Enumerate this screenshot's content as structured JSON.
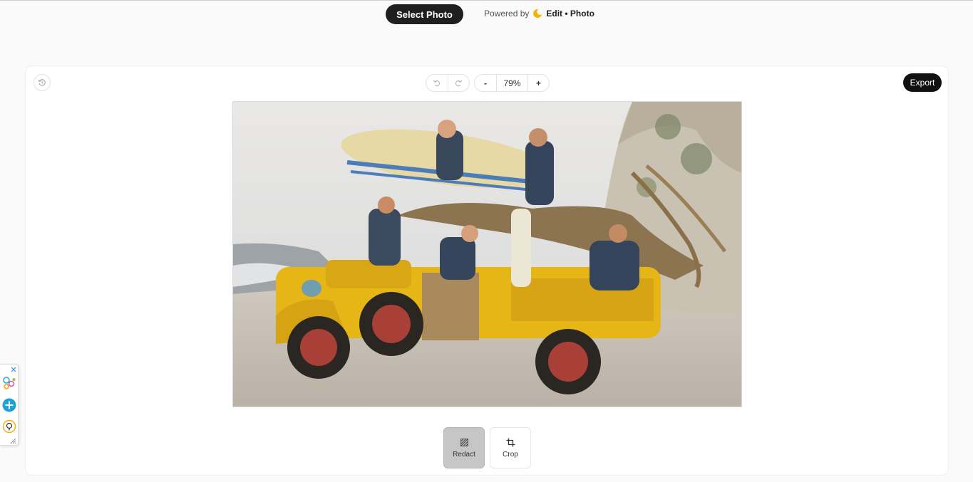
{
  "header": {
    "select_photo_label": "Select Photo",
    "powered_by_label": "Powered by",
    "brand_name": "Edit • Photo"
  },
  "toolbar": {
    "history_icon": "history-icon",
    "undo_icon": "undo-icon",
    "redo_icon": "redo-icon",
    "zoom_out_label": "-",
    "zoom_level": "79%",
    "zoom_in_label": "+",
    "export_label": "Export"
  },
  "tools": {
    "redact_label": "Redact",
    "crop_label": "Crop",
    "active_tool": "Redact"
  },
  "side_widget": {
    "icons": [
      "close-icon",
      "people-icon",
      "plus-circle-icon",
      "pin-icon",
      "resize-icon"
    ]
  },
  "colors": {
    "primary_button": "#1f1f1f",
    "brand_logo": "#f5b301",
    "active_tool_bg": "#c6c6c6",
    "side_plus": "#1aa3d6"
  }
}
